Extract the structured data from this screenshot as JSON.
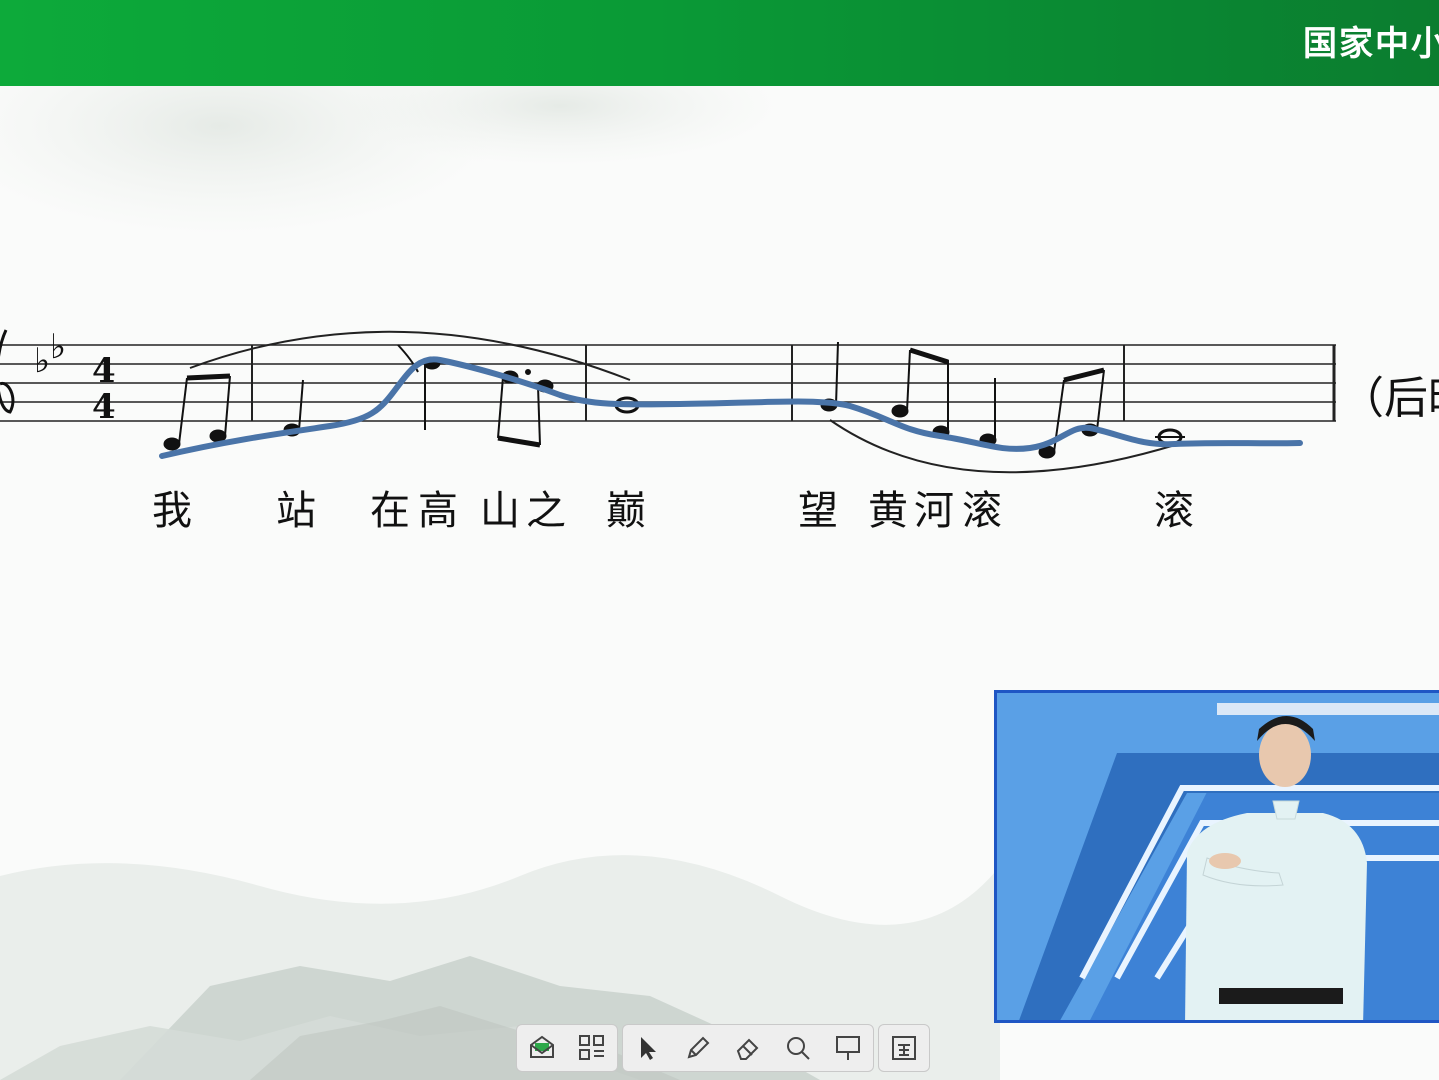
{
  "header": {
    "brand_text": "国家中小",
    "bar_color": "#0aa23a"
  },
  "score": {
    "contour_color": "#4a74a8",
    "lyrics": [
      "我",
      "站",
      "在",
      "高",
      "山",
      "之",
      "巅",
      "望",
      "黄",
      "河",
      "滚",
      "滚"
    ],
    "trailing_text": "（后昭"
  },
  "video": {
    "border_color": "#1f56c4"
  },
  "toolbar": {
    "groups": [
      [
        "mail-stack-icon",
        "grid-menu-icon"
      ],
      [
        "pointer-icon",
        "pen-icon",
        "eraser-icon",
        "magnifier-icon",
        "board-icon"
      ],
      [
        "fullscreen-icon"
      ]
    ]
  }
}
